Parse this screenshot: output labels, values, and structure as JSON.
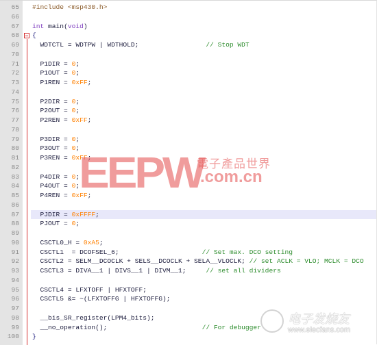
{
  "editor": {
    "highlighted_line": 87,
    "fold_marker_line": 68,
    "colors": {
      "gutter_bg": "#e4e4e4",
      "line_number": "#8c8c8c",
      "fold_marker": "#d42a2a",
      "current_line_bg": "#e8e8fa",
      "preprocessor": "#8a5a28",
      "keyword": "#8040c0",
      "number": "#ff8000",
      "comment": "#2c8c2c",
      "identifier": "#202040"
    },
    "lines": [
      {
        "n": "65",
        "tokens": [
          {
            "t": "pre",
            "v": "#include <msp430.h>"
          }
        ]
      },
      {
        "n": "66",
        "tokens": []
      },
      {
        "n": "67",
        "tokens": [
          {
            "t": "kw",
            "v": "int"
          },
          {
            "t": "id",
            "v": " main("
          },
          {
            "t": "kw",
            "v": "void"
          },
          {
            "t": "id",
            "v": ")"
          }
        ]
      },
      {
        "n": "68",
        "tokens": [
          {
            "t": "op",
            "v": "{"
          }
        ]
      },
      {
        "n": "69",
        "tokens": [
          {
            "t": "id",
            "v": "  WDTCTL = WDTPW | WDTHOLD;                 "
          },
          {
            "t": "cm",
            "v": "// Stop WDT"
          }
        ]
      },
      {
        "n": "70",
        "tokens": []
      },
      {
        "n": "71",
        "tokens": [
          {
            "t": "id",
            "v": "  P1DIR = "
          },
          {
            "t": "num",
            "v": "0"
          },
          {
            "t": "id",
            "v": ";"
          }
        ]
      },
      {
        "n": "72",
        "tokens": [
          {
            "t": "id",
            "v": "  P1OUT = "
          },
          {
            "t": "num",
            "v": "0"
          },
          {
            "t": "id",
            "v": ";"
          }
        ]
      },
      {
        "n": "73",
        "tokens": [
          {
            "t": "id",
            "v": "  P1REN = "
          },
          {
            "t": "num",
            "v": "0xFF"
          },
          {
            "t": "id",
            "v": ";"
          }
        ]
      },
      {
        "n": "74",
        "tokens": []
      },
      {
        "n": "75",
        "tokens": [
          {
            "t": "id",
            "v": "  P2DIR = "
          },
          {
            "t": "num",
            "v": "0"
          },
          {
            "t": "id",
            "v": ";"
          }
        ]
      },
      {
        "n": "76",
        "tokens": [
          {
            "t": "id",
            "v": "  P2OUT = "
          },
          {
            "t": "num",
            "v": "0"
          },
          {
            "t": "id",
            "v": ";"
          }
        ]
      },
      {
        "n": "77",
        "tokens": [
          {
            "t": "id",
            "v": "  P2REN = "
          },
          {
            "t": "num",
            "v": "0xFF"
          },
          {
            "t": "id",
            "v": ";"
          }
        ]
      },
      {
        "n": "78",
        "tokens": []
      },
      {
        "n": "79",
        "tokens": [
          {
            "t": "id",
            "v": "  P3DIR = "
          },
          {
            "t": "num",
            "v": "0"
          },
          {
            "t": "id",
            "v": ";"
          }
        ]
      },
      {
        "n": "80",
        "tokens": [
          {
            "t": "id",
            "v": "  P3OUT = "
          },
          {
            "t": "num",
            "v": "0"
          },
          {
            "t": "id",
            "v": ";"
          }
        ]
      },
      {
        "n": "81",
        "tokens": [
          {
            "t": "id",
            "v": "  P3REN = "
          },
          {
            "t": "num",
            "v": "0xFF"
          },
          {
            "t": "id",
            "v": ";"
          }
        ]
      },
      {
        "n": "82",
        "tokens": []
      },
      {
        "n": "83",
        "tokens": [
          {
            "t": "id",
            "v": "  P4DIR = "
          },
          {
            "t": "num",
            "v": "0"
          },
          {
            "t": "id",
            "v": ";"
          }
        ]
      },
      {
        "n": "84",
        "tokens": [
          {
            "t": "id",
            "v": "  P4OUT = "
          },
          {
            "t": "num",
            "v": "0"
          },
          {
            "t": "id",
            "v": ";"
          }
        ]
      },
      {
        "n": "85",
        "tokens": [
          {
            "t": "id",
            "v": "  P4REN = "
          },
          {
            "t": "num",
            "v": "0xFF"
          },
          {
            "t": "id",
            "v": ";"
          }
        ]
      },
      {
        "n": "86",
        "tokens": []
      },
      {
        "n": "87",
        "tokens": [
          {
            "t": "id",
            "v": "  PJDIR = "
          },
          {
            "t": "num",
            "v": "0xFFFF"
          },
          {
            "t": "id",
            "v": ";"
          }
        ]
      },
      {
        "n": "88",
        "tokens": [
          {
            "t": "id",
            "v": "  PJOUT = "
          },
          {
            "t": "num",
            "v": "0"
          },
          {
            "t": "id",
            "v": ";"
          }
        ]
      },
      {
        "n": "89",
        "tokens": []
      },
      {
        "n": "90",
        "tokens": [
          {
            "t": "id",
            "v": "  CSCTL0_H = "
          },
          {
            "t": "num",
            "v": "0xA5"
          },
          {
            "t": "id",
            "v": ";"
          }
        ]
      },
      {
        "n": "91",
        "tokens": [
          {
            "t": "id",
            "v": "  CSCTL1  = DCOFSEL_6;                     "
          },
          {
            "t": "cm",
            "v": "// Set max. DCO setting"
          }
        ]
      },
      {
        "n": "92",
        "tokens": [
          {
            "t": "id",
            "v": "  CSCTL2 = SELM__DCOCLK + SELS__DCOCLK + SELA__VLOCLK; "
          },
          {
            "t": "cm",
            "v": "// set ACLK = VLO; MCLK = DCO"
          }
        ]
      },
      {
        "n": "93",
        "tokens": [
          {
            "t": "id",
            "v": "  CSCTL3 = DIVA__1 | DIVS__1 | DIVM__1;     "
          },
          {
            "t": "cm",
            "v": "// set all dividers"
          }
        ]
      },
      {
        "n": "94",
        "tokens": []
      },
      {
        "n": "95",
        "tokens": [
          {
            "t": "id",
            "v": "  CSCTL4 = LFXTOFF | HFXTOFF;"
          }
        ]
      },
      {
        "n": "96",
        "tokens": [
          {
            "t": "id",
            "v": "  CSCTL5 &= ~(LFXTOFFG | HFXTOFFG);"
          }
        ]
      },
      {
        "n": "97",
        "tokens": []
      },
      {
        "n": "98",
        "tokens": [
          {
            "t": "id",
            "v": "  __bis_SR_register(LPM4_bits);"
          }
        ]
      },
      {
        "n": "99",
        "tokens": [
          {
            "t": "id",
            "v": "  __no_operation();                        "
          },
          {
            "t": "cm",
            "v": "// For debugger"
          }
        ]
      },
      {
        "n": "100",
        "tokens": [
          {
            "t": "op",
            "v": "}"
          }
        ]
      }
    ]
  },
  "watermarks": {
    "eepw": {
      "logo_text": "EEPW",
      "chinese": "電子產品世界",
      "domain": ".com.cn"
    },
    "elecfans": {
      "chinese": "电子发烧友",
      "url": "www.elecfans.com"
    }
  }
}
